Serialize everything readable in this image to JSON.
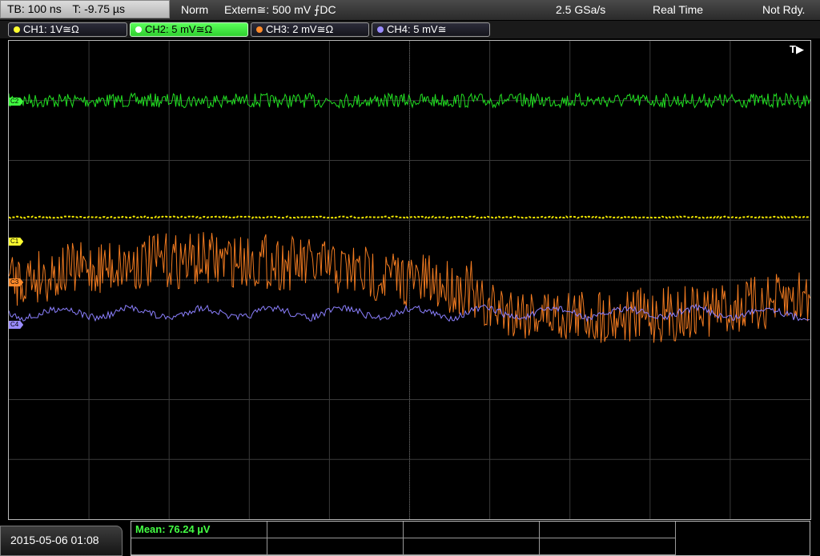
{
  "top_bar": {
    "timebase": "TB: 100 ns",
    "trigger_time": "T: -9.75 µs",
    "trigger_mode": "Norm",
    "trigger_source": "Extern≅: 500 mV ⨍DC",
    "sample_rate": "2.5 GSa/s",
    "acq_mode": "Real Time",
    "status": "Not Rdy."
  },
  "channels": [
    {
      "label": "CH1: 1V≅Ω",
      "color": "#ffff30",
      "active": false
    },
    {
      "label": "CH2: 5 mV≅Ω",
      "color": "#40ff40",
      "active": true
    },
    {
      "label": "CH3: 2 mV≅Ω",
      "color": "#ff8a2a",
      "active": false
    },
    {
      "label": "CH4: 5 mV≅",
      "color": "#9a8cff",
      "active": false
    }
  ],
  "grid": {
    "trigger_marker": "T▶",
    "channel_markers": [
      "C2",
      "C1",
      "C3",
      "C4"
    ]
  },
  "traces": {
    "ch1": {
      "color": "#f0e600",
      "level_div": 2.95
    },
    "ch2": {
      "color": "#22e022",
      "level_div": 1.0
    },
    "ch3": {
      "color": "#f07a20",
      "level_div": 4.0
    },
    "ch4": {
      "color": "#8c80ff",
      "level_div": 4.55
    }
  },
  "bottom": {
    "datetime": "2015-05-06 01:08",
    "measurement": "Mean: 76.24 µV"
  }
}
